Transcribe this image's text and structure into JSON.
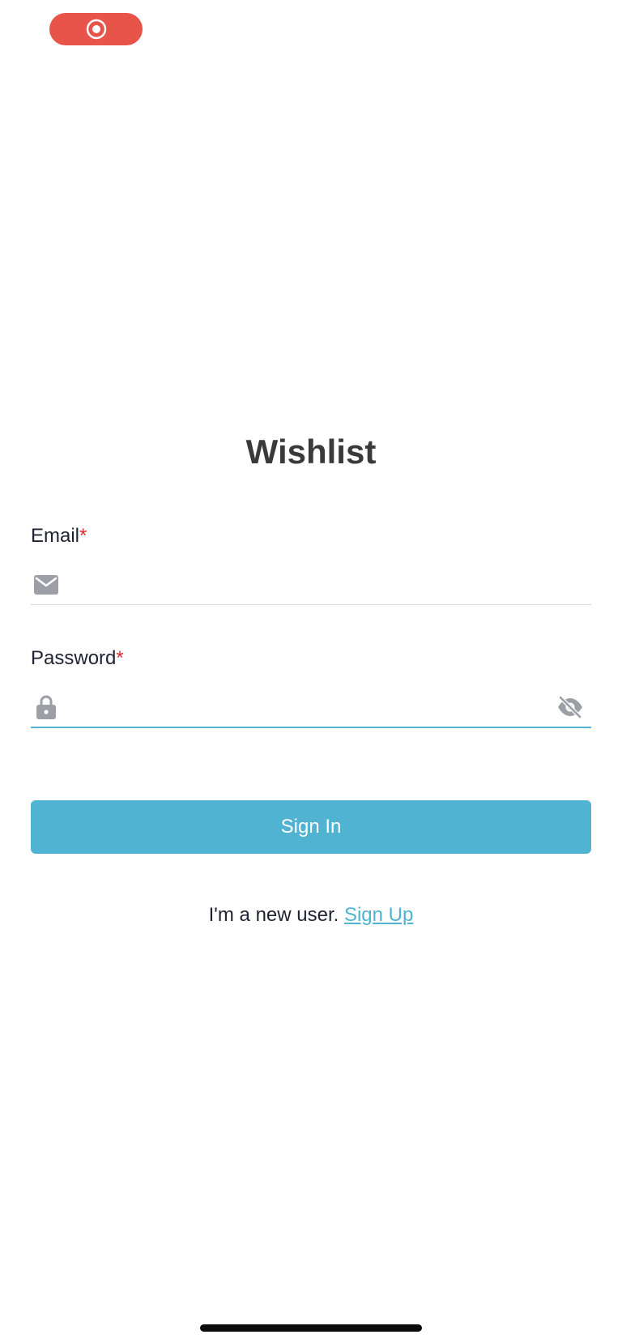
{
  "status": {
    "recording_icon": "screen-recording-icon",
    "recording_color": "#e8534a"
  },
  "app": {
    "title": "Wishlist"
  },
  "form": {
    "email": {
      "label": "Email",
      "required_mark": "*",
      "value": "",
      "icon": "envelope-icon"
    },
    "password": {
      "label": "Password",
      "required_mark": "*",
      "value": "",
      "icon": "lock-icon",
      "visibility_icon": "eye-off-icon"
    },
    "submit_label": "Sign In"
  },
  "signup": {
    "prompt": "I'm a new user.",
    "link_label": "Sign Up"
  },
  "colors": {
    "accent": "#4fb3d1",
    "required": "#d32f2f",
    "icon_gray": "#9e9ea6",
    "title": "#3a3a3a"
  }
}
